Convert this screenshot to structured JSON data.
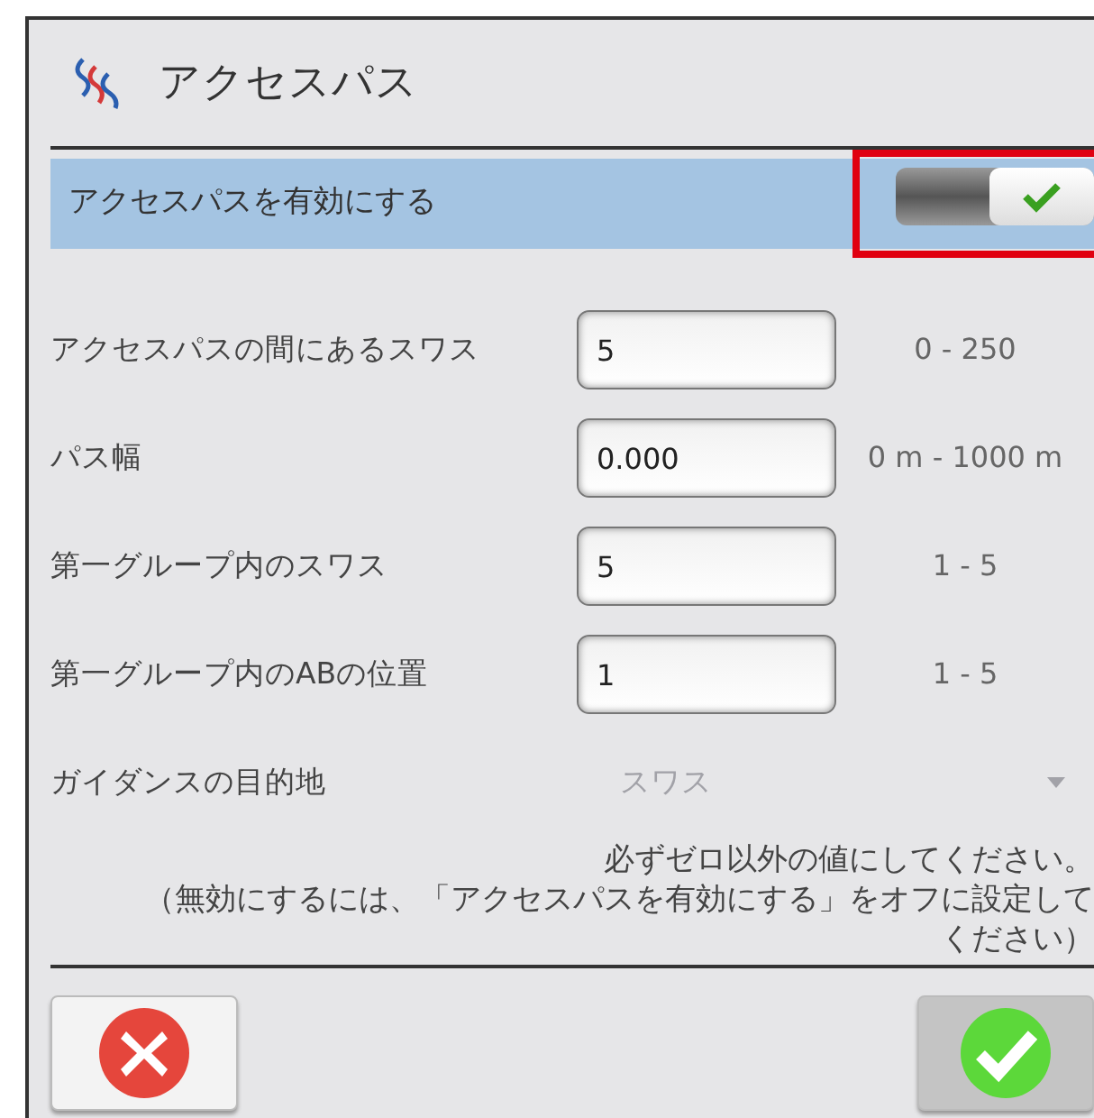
{
  "dialog": {
    "title": "アクセスパス"
  },
  "enable": {
    "label": "アクセスパスを有効にする",
    "on": true,
    "highlighted": true
  },
  "fields": [
    {
      "label": "アクセスパスの間にあるスワス",
      "value": "5",
      "range": "0 - 250"
    },
    {
      "label": "パス幅",
      "value": "0.000",
      "range": "0 m - 1000 m"
    },
    {
      "label": "第一グループ内のスワス",
      "value": "5",
      "range": "1 - 5"
    },
    {
      "label": "第一グループ内のABの位置",
      "value": "1",
      "range": "1 - 5"
    }
  ],
  "guidance": {
    "label": "ガイダンスの目的地",
    "value": "スワス",
    "disabled": true
  },
  "note": [
    "必ずゼロ以外の値にしてください。",
    "（無効にするには、「アクセスパスを有効にする」をオフに設定して",
    "ください）"
  ],
  "buttons": [
    {
      "kind": "cancel"
    },
    {
      "kind": "ok"
    }
  ]
}
